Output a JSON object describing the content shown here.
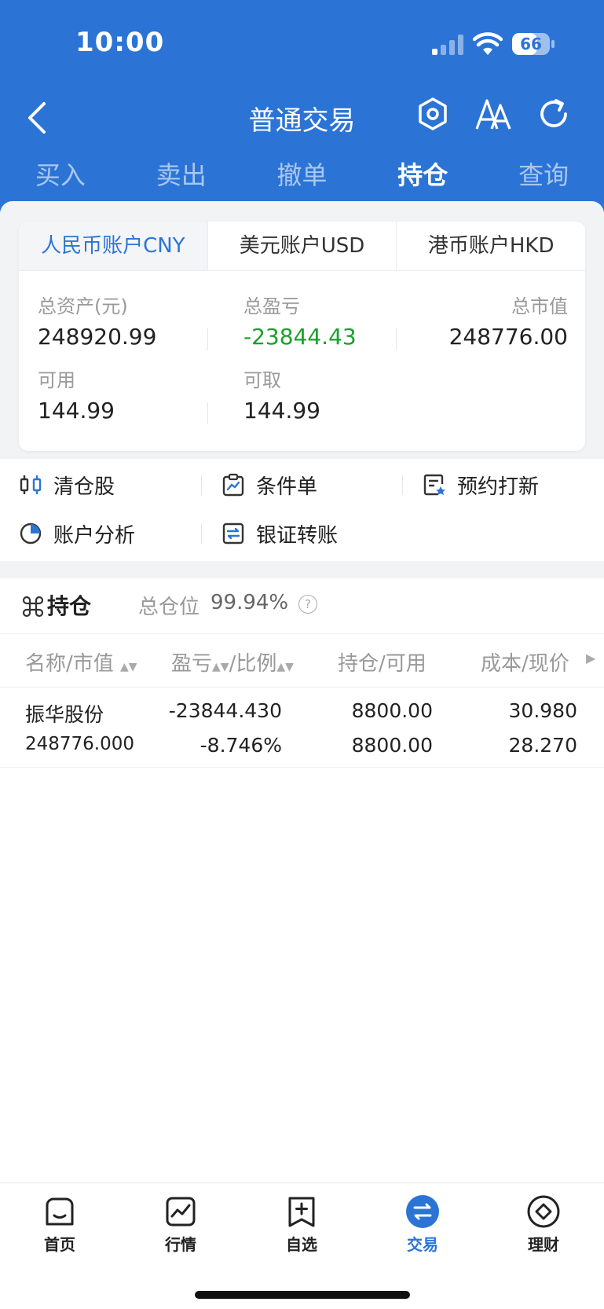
{
  "status": {
    "time": "10:00",
    "battery": "66",
    "battery_level": 0.66
  },
  "header": {
    "title": "普通交易"
  },
  "tabs": [
    "买入",
    "卖出",
    "撤单",
    "持仓",
    "查询"
  ],
  "active_tab": 3,
  "accounts": [
    "人民币账户CNY",
    "美元账户USD",
    "港币账户HKD"
  ],
  "summary": {
    "total_assets_label": "总资产(元)",
    "total_assets": "248920.99",
    "total_pnl_label": "总盈亏",
    "total_pnl": "-23844.43",
    "market_value_label": "总市值",
    "market_value": "248776.00",
    "available_label": "可用",
    "available": "144.99",
    "withdrawable_label": "可取",
    "withdrawable": "144.99"
  },
  "quick_actions": [
    "清仓股",
    "条件单",
    "预约打新",
    "账户分析",
    "银证转账"
  ],
  "holdings": {
    "title": "持仓",
    "position_label": "总仓位",
    "position_value": "99.94%",
    "columns": [
      "名称/市值",
      "盈亏",
      "/比例",
      "持仓/可用",
      "成本/现价"
    ],
    "rows": [
      {
        "name": "振华股份",
        "market_value": "248776.000",
        "pnl": "-23844.430",
        "pnl_ratio": "-8.746%",
        "position": "8800.00",
        "available": "8800.00",
        "cost": "30.980",
        "price": "28.270"
      }
    ]
  },
  "bottom_nav": [
    "首页",
    "行情",
    "自选",
    "交易",
    "理财"
  ],
  "colors": {
    "primary": "#2b74d6",
    "loss": "#1aa12a"
  }
}
